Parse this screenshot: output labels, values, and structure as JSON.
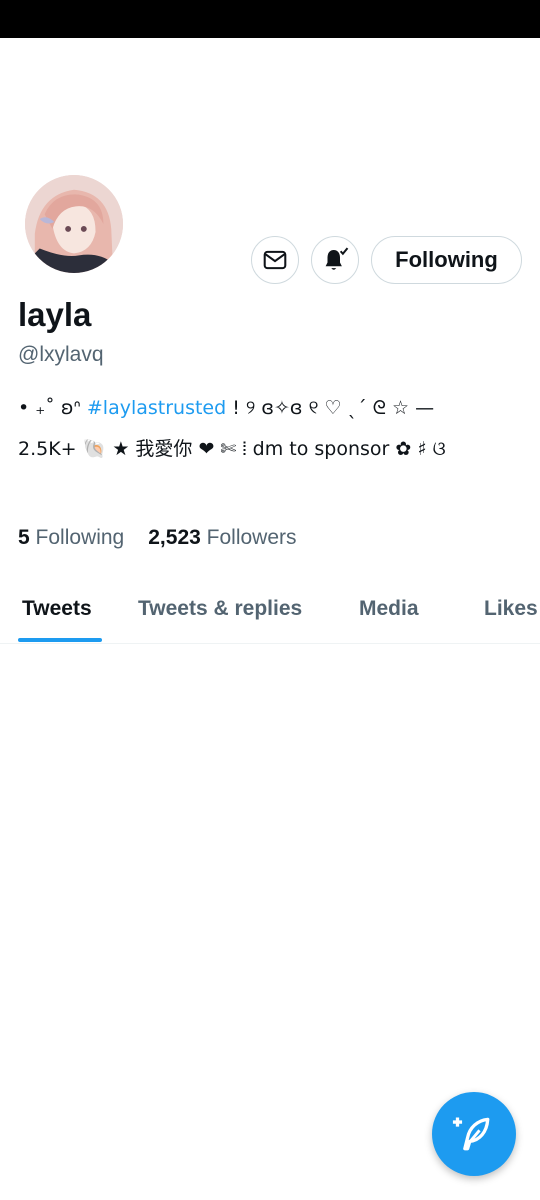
{
  "profile": {
    "display_name": "layla",
    "handle": "@lxylavq",
    "bio": {
      "line1_prefix": "• ₊˚ ʚᐢ",
      "hashtag": "#laylastrusted",
      "line1_suffix": "! ୨ ɞ✧ɞ ୧ ♡ ˎˊ ᘓ ☆ —",
      "line2": "2.5K+ 🐚 ★ 我愛你 ❤ ✄ ⦙ dm to sponsor ✿ ♯ ଓ"
    },
    "stats": {
      "following_count": "5",
      "following_label": "Following",
      "followers_count": "2,523",
      "followers_label": "Followers"
    }
  },
  "actions": {
    "message_icon": "envelope-icon",
    "notify_icon": "bell-check-icon",
    "follow_label": "Following"
  },
  "tabs": [
    {
      "label": "Tweets",
      "active": true
    },
    {
      "label": "Tweets & replies",
      "active": false
    },
    {
      "label": "Media",
      "active": false
    },
    {
      "label": "Likes",
      "active": false
    }
  ],
  "fab": {
    "icon": "compose-feather-plus-icon"
  },
  "colors": {
    "accent": "#1d9bf0",
    "text_primary": "#0f1419",
    "text_secondary": "#536471",
    "border": "#cfd9de"
  }
}
